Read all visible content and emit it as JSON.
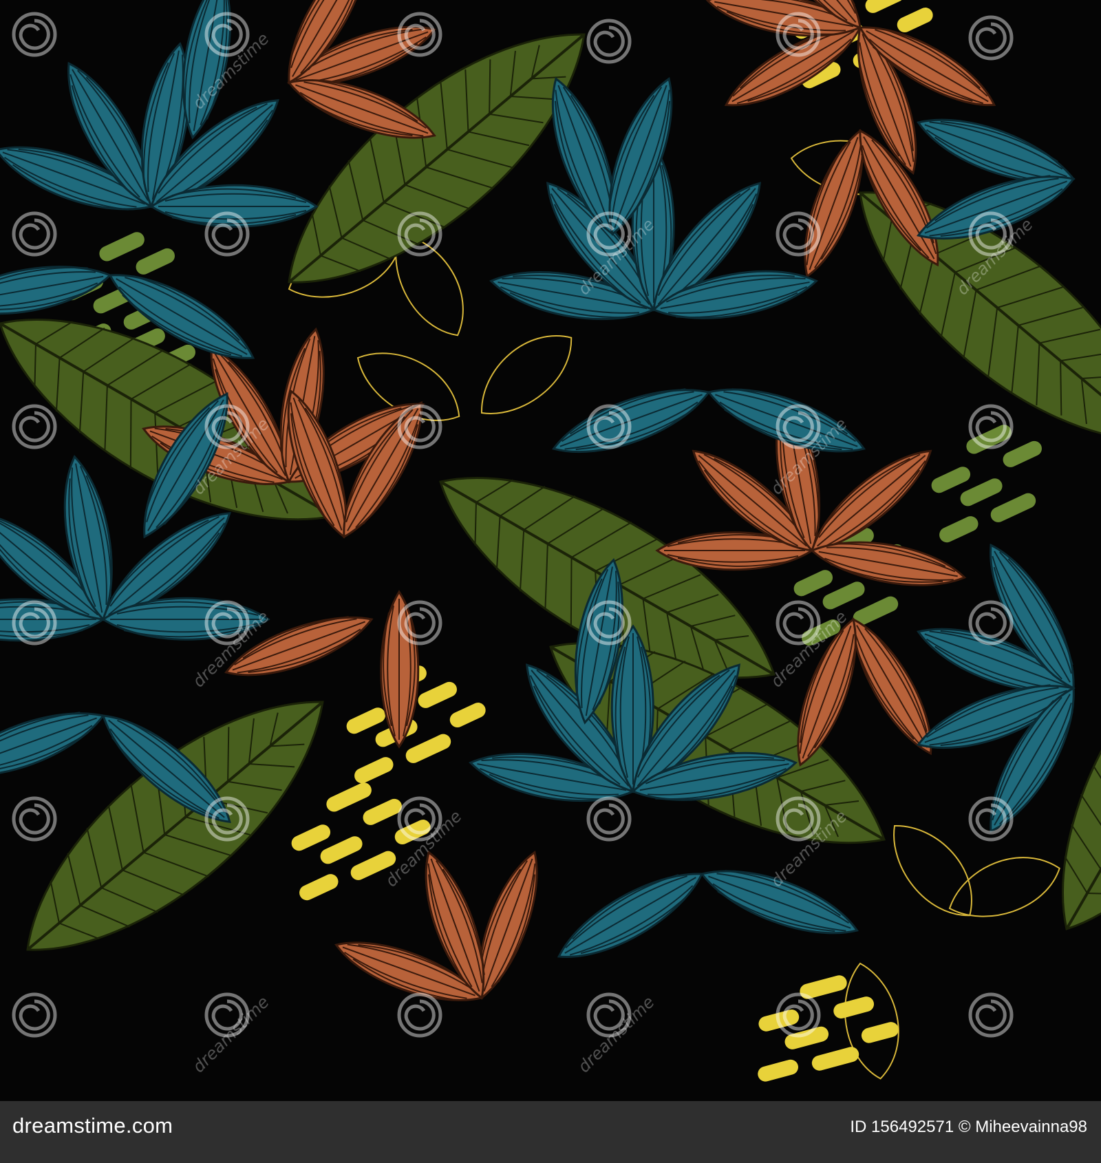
{
  "image": {
    "background_color": "#050505",
    "palette": {
      "teal": "#1f6b7d",
      "rust": "#b8623a",
      "olive": "#485f1e",
      "yellow": "#e8d23a",
      "pale_olive": "#6b8a35"
    }
  },
  "footer": {
    "logo_text": "dreamstime.com",
    "id_text": "ID 156492571 © Miheevainna98",
    "background": "#2f2f2f"
  },
  "watermark": {
    "text": "dreamstime"
  }
}
